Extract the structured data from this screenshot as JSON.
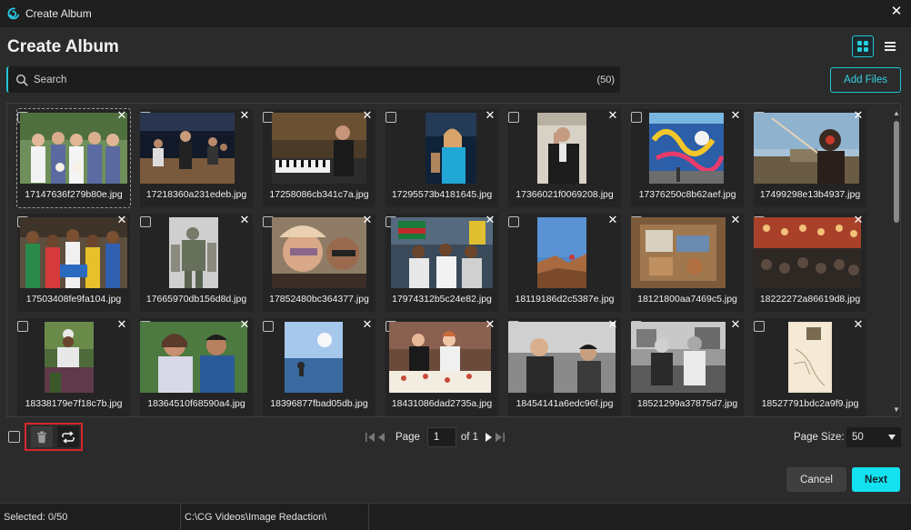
{
  "window": {
    "title": "Create Album"
  },
  "page": {
    "heading": "Create Album"
  },
  "search": {
    "placeholder": "Search",
    "count": "(50)"
  },
  "toolbar": {
    "add_files_label": "Add Files",
    "view_mode": "grid"
  },
  "colors": {
    "accent": "#20c5d8",
    "next_button": "#14e1f0",
    "highlight_box": "#d6262c"
  },
  "files": [
    {
      "name": "17147636f279b80e.jpg",
      "selected": true
    },
    {
      "name": "17218360a231edeb.jpg"
    },
    {
      "name": "17258086cb341c7a.jpg"
    },
    {
      "name": "17295573b4181645.jpg"
    },
    {
      "name": "17366021f0069208.jpg"
    },
    {
      "name": "17376250c8b62aef.jpg"
    },
    {
      "name": "17499298e13b4937.jpg"
    },
    {
      "name": "17503408fe9fa104.jpg"
    },
    {
      "name": "17665970db156d8d.jpg"
    },
    {
      "name": "17852480bc364377.jpg"
    },
    {
      "name": "17974312b5c24e82.jpg"
    },
    {
      "name": "18119186d2c5387e.jpg"
    },
    {
      "name": "18121800aa7469c5.jpg"
    },
    {
      "name": "18222272a86619d8.jpg"
    },
    {
      "name": "18338179e7f18c7b.jpg"
    },
    {
      "name": "18364510f68590a4.jpg"
    },
    {
      "name": "18396877fbad05db.jpg"
    },
    {
      "name": "18431086dad2735a.jpg"
    },
    {
      "name": "18454141a6edc96f.jpg"
    },
    {
      "name": "18521299a37875d7.jpg"
    },
    {
      "name": "18527791bdc2a9f9.jpg"
    }
  ],
  "pagination": {
    "page_label": "Page",
    "current_page": "1",
    "of_label": "of 1"
  },
  "page_size": {
    "label": "Page Size:",
    "value": "50"
  },
  "footer": {
    "cancel_label": "Cancel",
    "next_label": "Next"
  },
  "status": {
    "selected": "Selected: 0/50",
    "path": "C:\\CG Videos\\Image Redaction\\"
  },
  "icons": [
    "app-logo-icon",
    "close-icon",
    "grid-view-icon",
    "list-view-icon",
    "search-icon",
    "trash-icon",
    "repeat-icon",
    "first-page-icon",
    "prev-page-icon",
    "next-page-icon",
    "last-page-icon",
    "chevron-down-icon"
  ]
}
